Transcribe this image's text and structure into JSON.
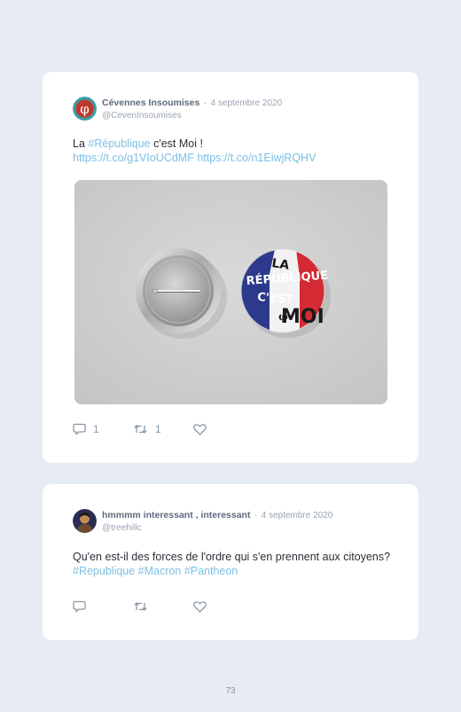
{
  "tweets": [
    {
      "author": "Cévennes Insoumises",
      "separator": "·",
      "date": "4 septembre 2020",
      "handle": "@CevenInsoumises",
      "text_prefix": "La ",
      "hashtag": "#République",
      "text_suffix": " c'est Moi !",
      "link1": "https://t.co/g1VIoUCdMF",
      "link2": "https://t.co/n1EiwjRQHV",
      "media": {
        "badge_line1": "LA",
        "badge_line2": "RÉPUBLIQUE",
        "badge_line3": "C'EST",
        "badge_line4": "MOI",
        "badge_symbol": "φ"
      },
      "reply_count": "1",
      "retweet_count": "1"
    },
    {
      "author": "hmmmm interessant , interessant",
      "separator": "·",
      "date": "4 septembre 2020",
      "handle": "@treehillc",
      "text": "Qu'en est-il des forces de l'ordre qui s'en prennent aux citoyens?",
      "hashtags": "#Republique #Macron #Pantheon",
      "reply_count": "",
      "retweet_count": ""
    }
  ],
  "page_number": "73",
  "colors": {
    "background": "#e6ebf4",
    "card": "#ffffff",
    "link": "#7cc0e3",
    "icon": "#8a97a8"
  },
  "icons": [
    "reply-icon",
    "retweet-icon",
    "like-icon"
  ]
}
